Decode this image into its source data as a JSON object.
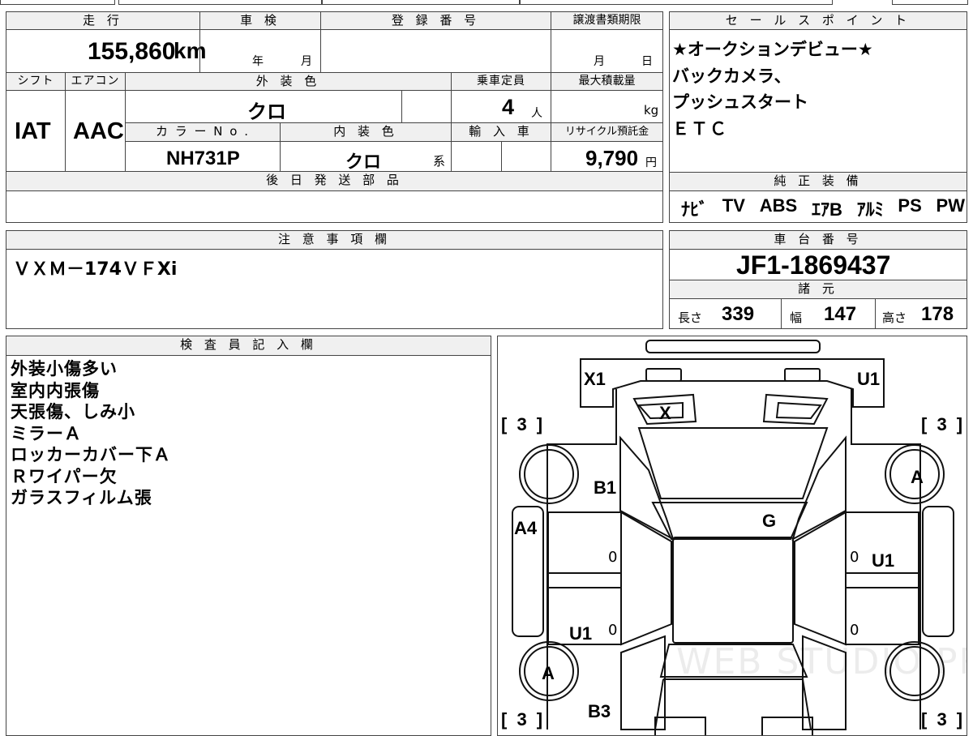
{
  "vehicle": {
    "mileage_label": "走 行",
    "mileage_value": "155,860",
    "mileage_unit": "km",
    "inspection_label": "車 検",
    "inspection_year": "年",
    "inspection_month": "月",
    "registration_label": "登 録 番 号",
    "registration_value": "",
    "transfer_deadline_label": "譲渡書類期限",
    "transfer_month": "月",
    "transfer_day": "日",
    "shift_label": "シフト",
    "shift_value": "IAT",
    "aircon_label": "エアコン",
    "aircon_value": "AAC",
    "exterior_color_label": "外 装 色",
    "exterior_color_value": "クロ",
    "capacity_label": "乗車定員",
    "capacity_value": "4",
    "capacity_unit": "人",
    "max_load_label": "最大積載量",
    "max_load_unit": "kg",
    "color_no_label": "カ ラ ー N o .",
    "color_no_value": "NH731P",
    "interior_color_label": "内 装 色",
    "interior_color_value": "クロ",
    "interior_color_suffix": "系",
    "import_label": "輸 入 車",
    "recycle_label": "リサイクル預託金",
    "recycle_value": "9,790",
    "recycle_unit": "円",
    "later_parts_label": "後 日 発 送 部 品"
  },
  "sales_points": {
    "header": "セ ー ル ス ポ イ ン ト",
    "lines": [
      "★オークションデビュー★",
      "バックカメラ、",
      "プッシュスタート",
      "ＥＴＣ"
    ]
  },
  "equipment": {
    "header": "純 正 装 備",
    "items": [
      "ﾅﾋﾞ",
      "TV",
      "ABS",
      "ｴｱB",
      "ｱﾙﾐ",
      "PS",
      "PW"
    ]
  },
  "notes": {
    "header": "注 意 事 項 欄",
    "text": "ＶＸＭ－174ＶＦXi"
  },
  "chassis": {
    "header": "車 台 番 号",
    "value": "JF1-1869437",
    "spec_header": "諸 元",
    "length_label": "長さ",
    "length_value": "339",
    "width_label": "幅",
    "width_value": "147",
    "height_label": "高さ",
    "height_value": "178"
  },
  "inspector": {
    "header": "検 査 員 記 入 欄",
    "lines": [
      "外装小傷多い",
      "室内内張傷",
      "天張傷、しみ小",
      "ミラーＡ",
      "ロッカーカバー下Ａ",
      "Ｒワイパー欠",
      "ガラスフィルム張"
    ]
  },
  "diagram": {
    "labels": {
      "x1": "X1",
      "u1_top": "U1",
      "x": "X",
      "tire_fl": "[ 3 ]",
      "tire_fr": "[ 3 ]",
      "b1": "B1",
      "a_right": "A",
      "g": "G",
      "a4": "A4",
      "zero1": "0",
      "zero2": "0",
      "u1_right": "U1",
      "u1_left": "U1",
      "zero3": "0",
      "zero4": "0",
      "a_left": "A",
      "tire_rl": "[ 3 ]",
      "b3": "B3",
      "tire_rr": "[ 3 ]"
    },
    "watermark": "WEB STUDIO PRO"
  }
}
